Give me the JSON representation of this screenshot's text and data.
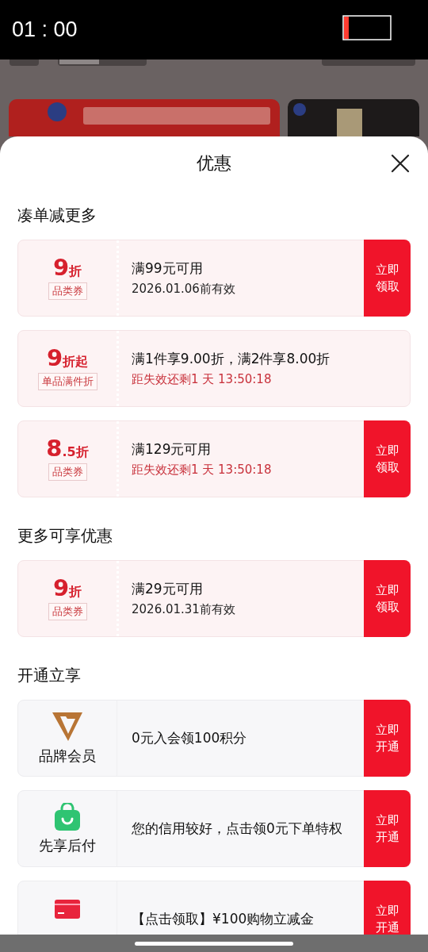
{
  "status_bar": {
    "time": "01 : 00"
  },
  "sheet": {
    "title": "优惠"
  },
  "sections": [
    {
      "title": "凑单减更多",
      "items": [
        {
          "kind": "coupon",
          "value": "9",
          "unit": "折",
          "tag": "品类券",
          "text": "满99元可用",
          "note": "2026.01.06前有效",
          "urgent": false,
          "button": "立即领取"
        },
        {
          "kind": "coupon",
          "value": "9",
          "unit": "折起",
          "tag": "单品满件折",
          "text": "满1件享9.00折，满2件享8.00折",
          "note": "距失效还剩1 天 13:50:18",
          "urgent": true
        },
        {
          "kind": "coupon",
          "value": "8",
          "unit": ".5折",
          "tag": "品类券",
          "text": "满129元可用",
          "note": "距失效还剩1 天 13:50:18",
          "urgent": true,
          "button": "立即领取"
        }
      ]
    },
    {
      "title": "更多可享优惠",
      "items": [
        {
          "kind": "coupon",
          "value": "9",
          "unit": "折",
          "tag": "品类券",
          "text": "满29元可用",
          "note": "2026.01.31前有效",
          "urgent": false,
          "button": "立即领取"
        }
      ]
    },
    {
      "title": "开通立享",
      "items": [
        {
          "kind": "vip",
          "label": "品牌会员",
          "text": "0元入会领100积分",
          "button": "立即开通"
        },
        {
          "kind": "bag",
          "label": "先享后付",
          "text": "您的信用较好，点击领0元下单特权",
          "button": "立即开通"
        },
        {
          "kind": "card",
          "text": "【点击领取】¥100购物立减金",
          "button": "立即开通"
        }
      ]
    }
  ]
}
